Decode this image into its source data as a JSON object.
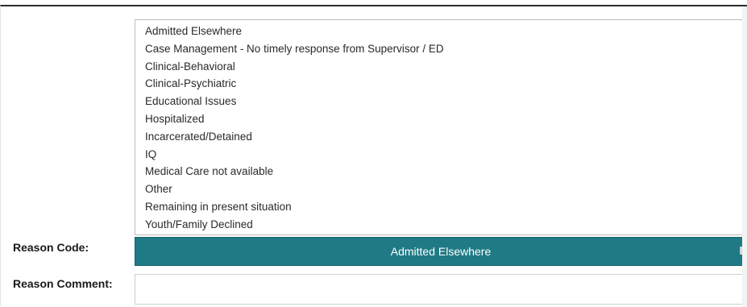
{
  "reason_code": {
    "label": "Reason Code:",
    "selected": "Admitted Elsewhere",
    "options": [
      "Admitted Elsewhere",
      "Case Management - No timely response from Supervisor / ED",
      "Clinical-Behavioral",
      "Clinical-Psychiatric",
      "Educational Issues",
      "Hospitalized",
      "Incarcerated/Detained",
      "IQ",
      "Medical Care not available",
      "Other",
      "Remaining in present situation",
      "Youth/Family Declined"
    ]
  },
  "reason_comment": {
    "label": "Reason Comment:",
    "value": ""
  },
  "colors": {
    "select_background": "#1f7a85",
    "select_text": "#ffffff"
  }
}
